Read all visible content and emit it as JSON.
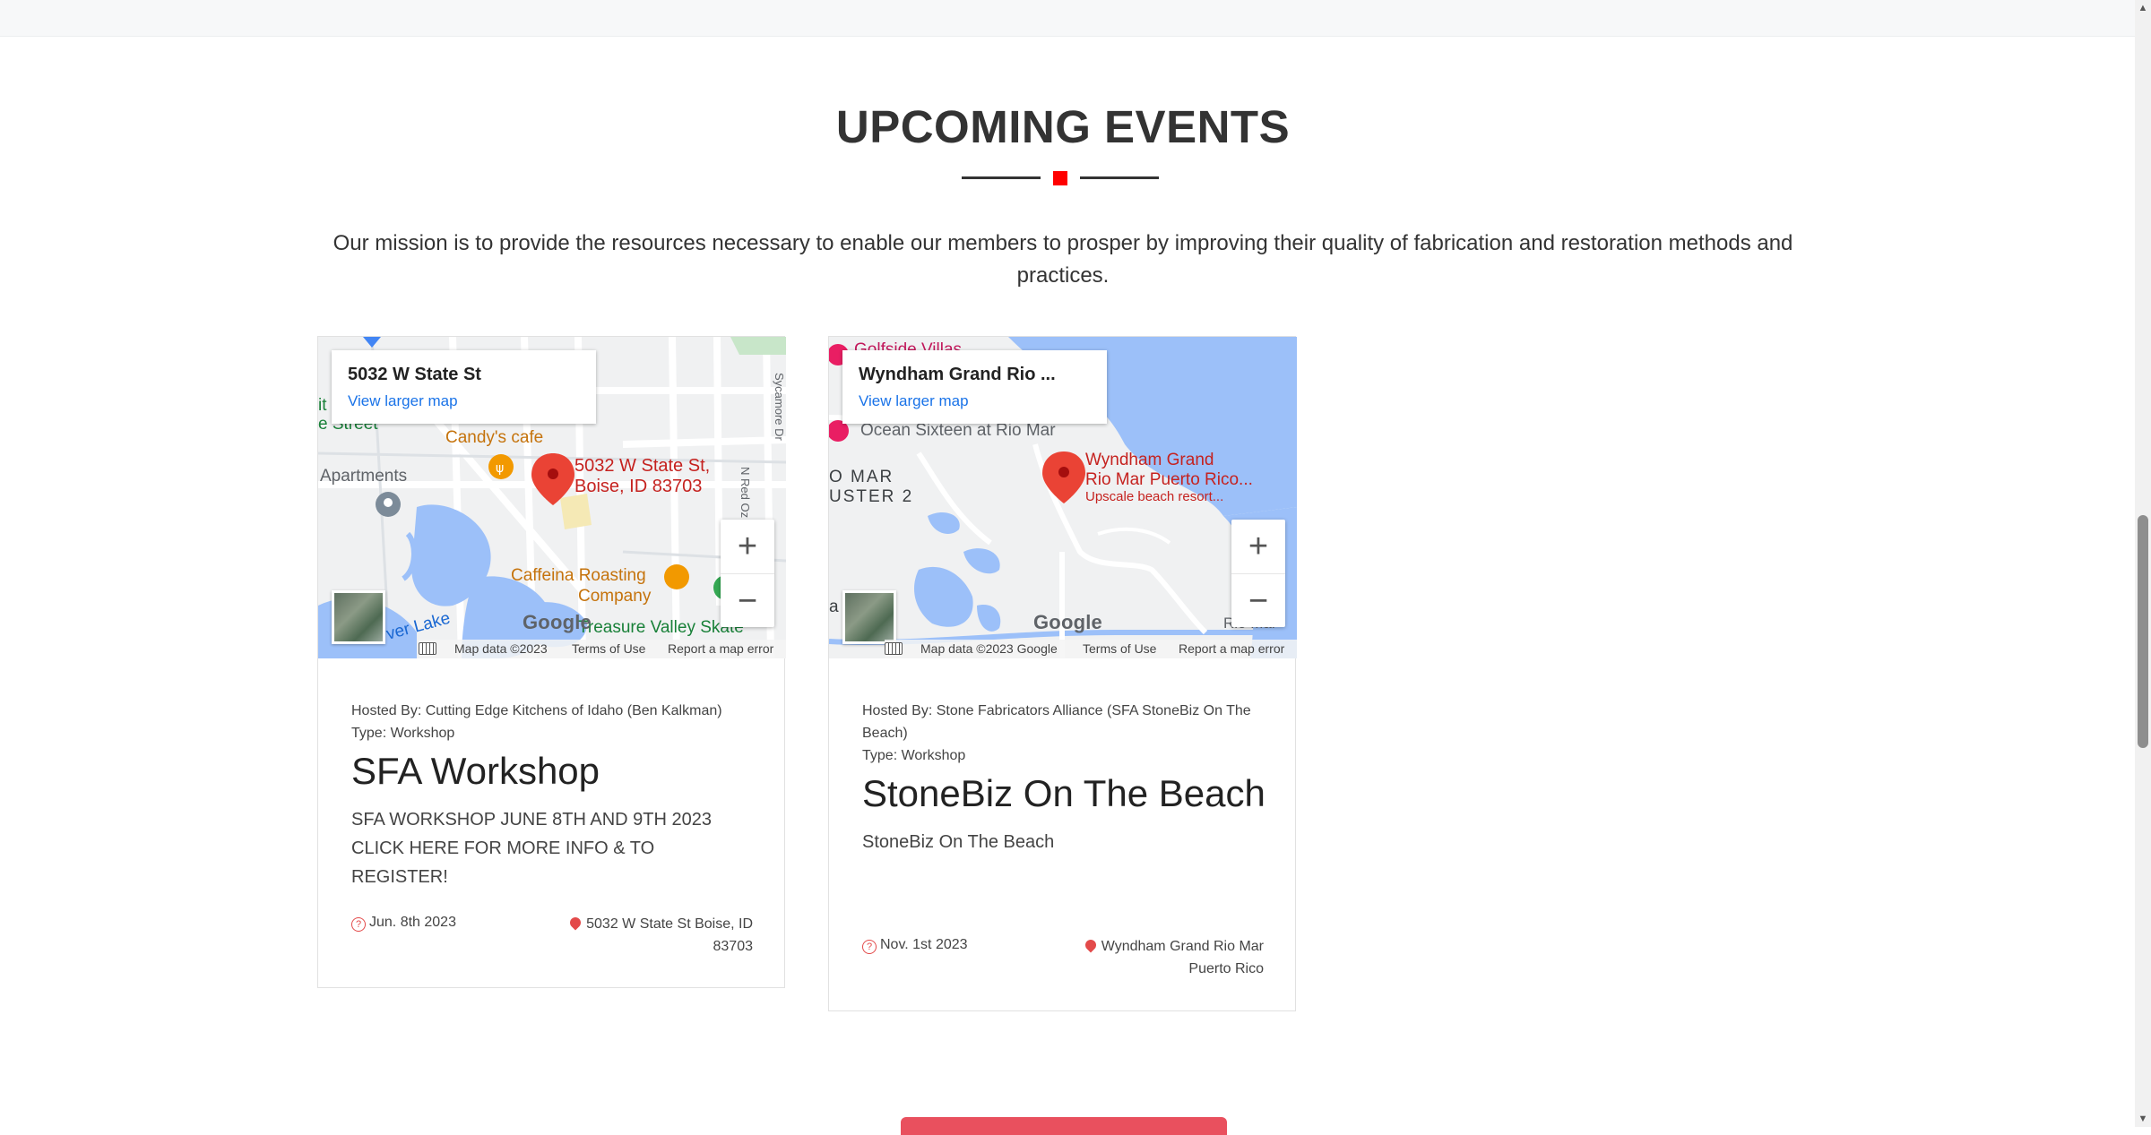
{
  "section": {
    "title": "UPCOMING EVENTS",
    "mission": "Our mission is to provide the resources necessary to enable our members to prosper by improving their quality of fabrication and restoration methods and practices."
  },
  "events": [
    {
      "map": {
        "info_title": "5032 W State St",
        "info_link": "View larger map",
        "labels": {
          "candys": "Candy's cafe",
          "pin_line1": "5032 W State St,",
          "pin_line2": "Boise, ID 83703",
          "apartments": "Apartments",
          "street": "e Street",
          "it": "it",
          "caffeina1": "Caffeina Roasting",
          "caffeina2": "Company",
          "treasure": "Treasure Valley Skate",
          "silver": "ver Lake",
          "sycamore": "Sycamore Dr",
          "nred": "N Red Oz"
        },
        "google": "Google",
        "map_data": "Map data ©2023",
        "terms": "Terms of Use",
        "report": "Report a map error"
      },
      "hosted": "Hosted By: Cutting Edge Kitchens of Idaho (Ben Kalkman)",
      "type": "Type: Workshop",
      "title": "SFA Workshop",
      "desc_line1": "SFA WORKSHOP JUNE 8TH AND 9TH 2023",
      "desc_line2": "CLICK HERE FOR MORE INFO & TO REGISTER!",
      "date": "Jun. 8th 2023",
      "location_line1": "5032 W State St Boise, ID",
      "location_line2": "83703"
    },
    {
      "map": {
        "info_title": "Wyndham Grand Rio ...",
        "info_link": "View larger map",
        "labels": {
          "ocean": "Ocean Sixteen at Rio Mar",
          "golfside": "Golfside Villas",
          "pin_line1": "Wyndham Grand",
          "pin_line2": "Rio Mar Puerto Rico...",
          "pin_line3": "Upscale beach resort...",
          "omar": "O MAR",
          "uster": "USTER 2",
          "rico": "a Rico",
          "riomar": "Rio Mar"
        },
        "google": "Google",
        "map_data": "Map data ©2023 Google",
        "terms": "Terms of Use",
        "report": "Report a map error"
      },
      "hosted": "Hosted By: Stone Fabricators Alliance (SFA StoneBiz On The Beach)",
      "type": "Type: Workshop",
      "title": "StoneBiz On The Beach",
      "desc_line1": "StoneBiz On The Beach",
      "date": "Nov. 1st 2023",
      "location_line1": "Wyndham Grand Rio Mar",
      "location_line2": "Puerto Rico"
    }
  ],
  "icons": {
    "date": "question-circle-icon",
    "location": "map-pin-icon",
    "zoom_in": "plus-icon",
    "zoom_out": "minus-icon",
    "keyboard": "keyboard-icon"
  },
  "colors": {
    "accent": "#ff0000",
    "button": "#e9505e",
    "link": "#1a73e8",
    "map_water": "#9cc0f9",
    "map_land": "#f0f1f2",
    "pin": "#ea4335"
  }
}
